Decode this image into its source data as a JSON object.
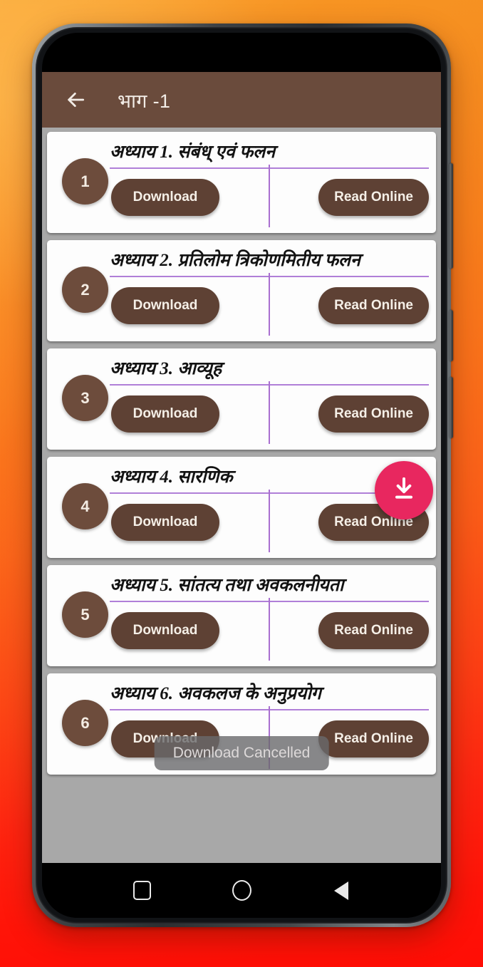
{
  "app": {
    "header": {
      "back_icon": "arrow-left-icon",
      "title": "भाग -1"
    },
    "download_label": "Download",
    "read_label": "Read Online",
    "chapters": [
      {
        "number": "1",
        "title": "अध्याय 1. संबंध् एवं फलन"
      },
      {
        "number": "2",
        "title": "अध्याय 2. प्रतिलोम त्रिकोणमितीय फलन"
      },
      {
        "number": "3",
        "title": "अध्याय 3.  आव्यूह"
      },
      {
        "number": "4",
        "title": "अध्याय 4.  सारणिक"
      },
      {
        "number": "5",
        "title": "अध्याय 5.  सांतत्य तथा अवकलनीयता"
      },
      {
        "number": "6",
        "title": "अध्याय 6.  अवकलज के  अनुप्रयोग"
      }
    ],
    "fab": {
      "icon": "download-icon",
      "on_card_index": 4
    },
    "toast": {
      "message": "Download Cancelled"
    },
    "navbar": {
      "recents_icon": "square-icon",
      "home_icon": "circle-icon",
      "back_icon": "triangle-back-icon"
    }
  },
  "colors": {
    "appbar_brown": "#6a4b3c",
    "button_brown": "#5e4134",
    "badge_brown": "#6d4c3c",
    "divider_purple": "#b07fd8",
    "fab_pink": "#e8275f",
    "list_background": "#a8a8a8",
    "card_white": "#fdfdfd"
  }
}
